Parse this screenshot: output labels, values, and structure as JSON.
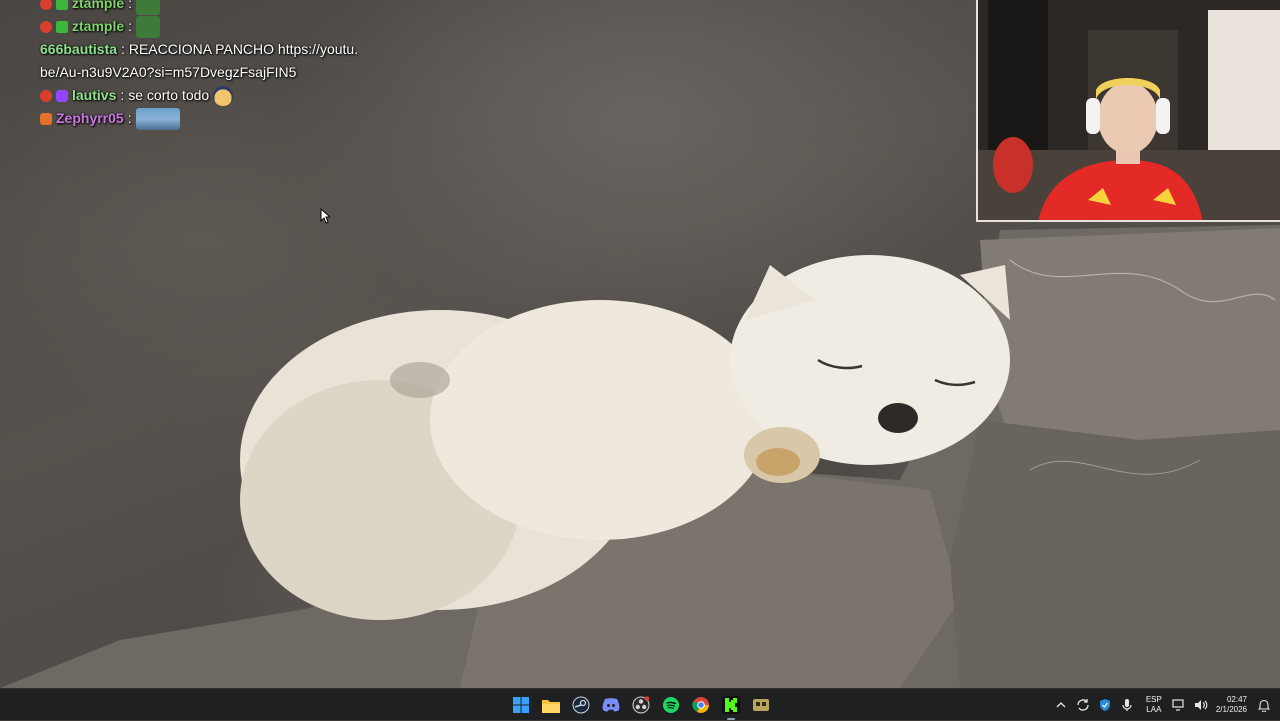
{
  "chat": {
    "messages": [
      {
        "badges": [
          "red",
          "green"
        ],
        "user": "ztample",
        "user_color": "#7ed36a",
        "text": "",
        "emote": "pepe-emote"
      },
      {
        "badges": [
          "red",
          "green"
        ],
        "user": "ztample",
        "user_color": "#7ed36a",
        "text": "",
        "emote": "pepe-emote"
      },
      {
        "badges": [],
        "user": "666bautista",
        "user_color": "#8fe08f",
        "text": "REACCIONA PANCHO https://youtu.be/Au-n3u9V2A0?si=m57DvegzFsajFIN5",
        "emote": ""
      },
      {
        "badges": [
          "red",
          "purple"
        ],
        "user": "lautivs",
        "user_color": "#8fe08f",
        "text": "se corto todo",
        "emote": "face-emote"
      },
      {
        "badges": [
          "orange"
        ],
        "user": "Zephyrr05",
        "user_color": "#c978e0",
        "text": "",
        "emote": "picture-emote"
      }
    ]
  },
  "taskbar": {
    "apps": [
      {
        "name": "windows-start-icon",
        "active": false
      },
      {
        "name": "file-explorer-icon",
        "active": false
      },
      {
        "name": "steam-icon",
        "active": false
      },
      {
        "name": "discord-icon",
        "active": false
      },
      {
        "name": "obs-icon",
        "active": false
      },
      {
        "name": "spotify-icon",
        "active": false
      },
      {
        "name": "chrome-icon",
        "active": false
      },
      {
        "name": "kick-icon",
        "active": true
      },
      {
        "name": "streamlabs-icon",
        "active": false
      }
    ],
    "tray": {
      "lang_top": "ESP",
      "lang_bottom": "LAA",
      "time": "02:47",
      "date": "2/1/2026"
    }
  },
  "colors": {
    "taskbar_bg": "#1e2022",
    "accent_green": "#53fc18"
  }
}
